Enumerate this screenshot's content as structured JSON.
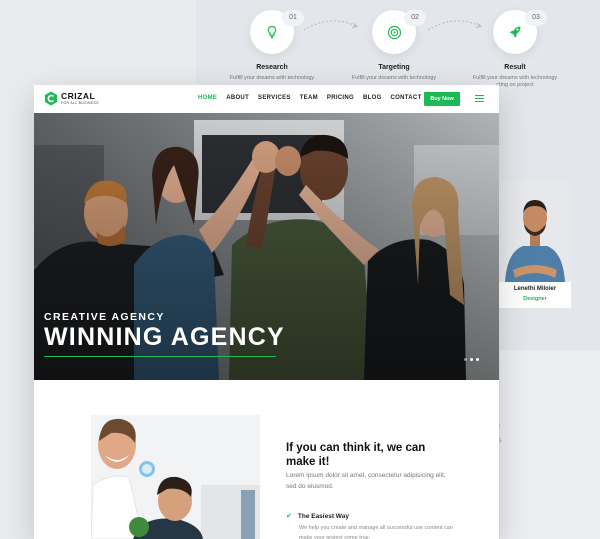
{
  "steps": [
    {
      "num": "01",
      "title": "Research",
      "desc": "Fulfill your dreams with technology",
      "icon": "bulb-icon"
    },
    {
      "num": "02",
      "title": "Targeting",
      "desc": "Fulfill your dreams with technology",
      "icon": "target-icon"
    },
    {
      "num": "03",
      "title": "Result",
      "desc": "Fulfill your dreams with technology",
      "desc2": "cting on project",
      "icon": "rocket-icon"
    }
  ],
  "team": {
    "name": "Lenethi Miloier",
    "role": "Designer"
  },
  "right_bits": [
    "t",
    "s"
  ],
  "nav": {
    "logo_title": "CRIZAL",
    "logo_sub": "FOR ALL BUSINESS",
    "items": [
      "HOME",
      "ABOUT",
      "SERVICES",
      "TEAM",
      "PRICING",
      "BLOG",
      "CONTACT"
    ],
    "active": "HOME",
    "buy_label": "Buy Now"
  },
  "hero": {
    "subtitle": "CREATIVE AGENCY",
    "title": "WINNING AGENCY"
  },
  "about": {
    "title": "If you can think it, we can make it!",
    "text": "Lorem ipsum dolor sit amet, consectetur adipisicing elit, sed do eiusmod.",
    "feature_title": "The Easiest Way",
    "feature_desc": "We help you create and manage all successful use content can make your project come true."
  },
  "colors": {
    "accent": "#1db954",
    "dark": "#111111"
  }
}
